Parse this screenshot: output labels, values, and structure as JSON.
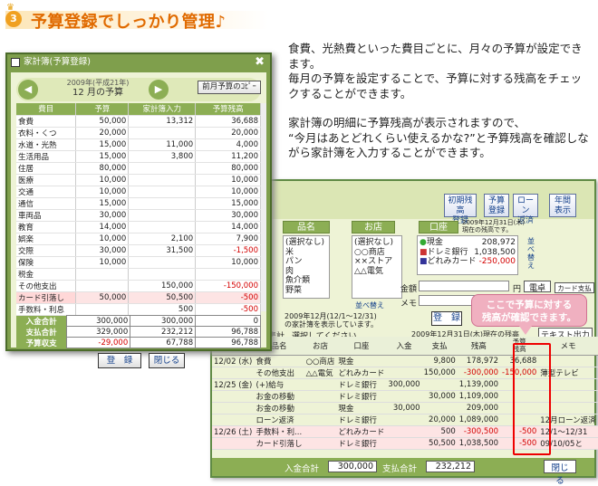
{
  "header": {
    "number": "3",
    "title": "予算登録でしっかり管理♪"
  },
  "description": [
    "食費、光熱費といった費目ごとに、月々の予算が設定できます。\n毎月の予算を設定することで、予算に対する残高をチェックすることができます。",
    "家計簿の明細に予算残高が表示されますので、\n“今月はあとどれくらい使えるかな?”と予算残高を確認しながら家計簿を入力することができます。"
  ],
  "budget_window": {
    "title": "家計簿(予算登録)",
    "close": "✖",
    "year_label": "2009年(平成21年)",
    "month_label": "12 月の予算",
    "copy_button": "前月予算のｺﾋﾟｰ",
    "columns": [
      "費目",
      "予算",
      "家計簿入力",
      "予算残高"
    ],
    "rows": [
      {
        "name": "食費",
        "budget": "50,000",
        "input": "13,312",
        "remain": "36,688"
      },
      {
        "name": "衣料・くつ",
        "budget": "20,000",
        "input": "",
        "remain": "20,000"
      },
      {
        "name": "水道・光熱",
        "budget": "15,000",
        "input": "11,000",
        "remain": "4,000"
      },
      {
        "name": "生活用品",
        "budget": "15,000",
        "input": "3,800",
        "remain": "11,200"
      },
      {
        "name": "住居",
        "budget": "80,000",
        "input": "",
        "remain": "80,000"
      },
      {
        "name": "医療",
        "budget": "10,000",
        "input": "",
        "remain": "10,000"
      },
      {
        "name": "交通",
        "budget": "10,000",
        "input": "",
        "remain": "10,000"
      },
      {
        "name": "通信",
        "budget": "15,000",
        "input": "",
        "remain": "15,000"
      },
      {
        "name": "車両品",
        "budget": "30,000",
        "input": "",
        "remain": "30,000"
      },
      {
        "name": "教育",
        "budget": "14,000",
        "input": "",
        "remain": "14,000"
      },
      {
        "name": "娯楽",
        "budget": "10,000",
        "input": "2,100",
        "remain": "7,900"
      },
      {
        "name": "交際",
        "budget": "30,000",
        "input": "31,500",
        "remain": "-1,500"
      },
      {
        "name": "保険",
        "budget": "10,000",
        "input": "",
        "remain": "10,000"
      },
      {
        "name": "税金",
        "budget": "",
        "input": "",
        "remain": ""
      },
      {
        "name": "その他支出",
        "budget": "",
        "input": "150,000",
        "remain": "-150,000"
      },
      {
        "name": "カード引落し",
        "budget": "50,000",
        "input": "50,500",
        "remain": "-500"
      },
      {
        "name": "手数料・利息",
        "budget": "",
        "input": "500",
        "remain": "-500"
      }
    ],
    "totals": [
      {
        "label": "入金合計",
        "a": "300,000",
        "b": "300,000",
        "c": "0"
      },
      {
        "label": "支払合計",
        "a": "329,000",
        "b": "232,212",
        "c": "96,788"
      },
      {
        "label": "予算収支",
        "a": "-29,000",
        "b": "67,788",
        "c": "96,788"
      }
    ],
    "register_button": "登　録",
    "close_button": "閉じる"
  },
  "ledger_window": {
    "top_buttons": [
      "初期残高\n登録",
      "予算\n登録",
      "ローン\n返済",
      "年間\n表示"
    ],
    "move_label": "移動",
    "item_header": "品名",
    "shop_header": "お店",
    "account_header": "口座",
    "item_list": [
      "(選択なし)",
      "米",
      "パン",
      "肉",
      "魚介類",
      "野菜"
    ],
    "shop_list": [
      "(選択なし)",
      "○○商店",
      "××ストア",
      "△△電気"
    ],
    "account_date": "2009年12月31日(木)\n現在の残高です。",
    "accounts": [
      {
        "name": "現金",
        "amount": "208,972"
      },
      {
        "name": "ドレミ銀行",
        "amount": "1,038,500"
      },
      {
        "name": "どれみカード",
        "amount": "-250,000"
      }
    ],
    "amount_label": "金額",
    "memo_label": "メモ",
    "yen": "円",
    "calc_button": "電卓",
    "card_button": "カード支払",
    "sort_label": "並べ替え",
    "register_button": "登　録",
    "period_label": "2009年12月(12/1～12/31)\nの家計簿を表示しています。",
    "mode_label": "集計",
    "mode2": "口座別",
    "select_none": "選択してください",
    "as_of": "2009年12月31日(木)現在の残高",
    "text_output": "テキスト出力",
    "grid_columns": [
      "",
      "品名",
      "お店",
      "口座",
      "入金",
      "支払",
      "残高",
      "予算\n残高",
      "メモ"
    ],
    "grid_rows": [
      {
        "date": "12/02 (水)",
        "cat": "食費",
        "item": "",
        "shop": "○○商店",
        "acct": "現金",
        "in": "",
        "out": "9,800",
        "bal": "178,972",
        "bud": "36,688",
        "memo": "",
        "red": false
      },
      {
        "date": "",
        "cat": "その他支出",
        "item": "",
        "shop": "△△電気",
        "acct": "どれみカード",
        "in": "",
        "out": "150,000",
        "bal": "-300,000",
        "bud": "-150,000",
        "memo": "薄型テレビ",
        "red": true
      },
      {
        "date": "12/25 (金)",
        "cat": "(+)給与",
        "item": "",
        "shop": "",
        "acct": "ドレミ銀行",
        "in": "300,000",
        "out": "",
        "bal": "1,139,000",
        "bud": "",
        "memo": "",
        "red": false
      },
      {
        "date": "",
        "cat": "お金の移動",
        "item": "(出)",
        "shop": "",
        "acct": "ドレミ銀行",
        "in": "",
        "out": "30,000",
        "bal": "1,109,000",
        "bud": "",
        "memo": "",
        "red": false
      },
      {
        "date": "",
        "cat": "お金の移動",
        "item": "(入)",
        "shop": "",
        "acct": "現金",
        "in": "30,000",
        "out": "",
        "bal": "209,000",
        "bud": "",
        "memo": "",
        "red": false
      },
      {
        "date": "",
        "cat": "ローン返済",
        "item": "自動車ローン",
        "shop": "",
        "acct": "ドレミ銀行",
        "in": "",
        "out": "20,000",
        "bal": "1,089,000",
        "bud": "",
        "memo": "12月ローン返済",
        "red": false
      },
      {
        "date": "12/26 (土)",
        "cat": "手数料・利...",
        "item": "手数料・利...",
        "shop": "",
        "acct": "どれみカード",
        "in": "",
        "out": "500",
        "bal": "-300,500",
        "bud": "-500",
        "memo": "12/1〜12/31",
        "red": true
      },
      {
        "date": "",
        "cat": "カード引落し",
        "item": "どれみカード",
        "shop": "",
        "acct": "ドレミ銀行",
        "in": "",
        "out": "50,500",
        "bal": "1,038,500",
        "bud": "-500",
        "memo": "09/10/05と",
        "red": true
      }
    ],
    "income_total_label": "入金合計",
    "income_total": "300,000",
    "payment_total_label": "支払合計",
    "payment_total": "232,212",
    "close_button": "閉じる"
  },
  "callout": "ここで予算に対する\n残高が確認できます。"
}
